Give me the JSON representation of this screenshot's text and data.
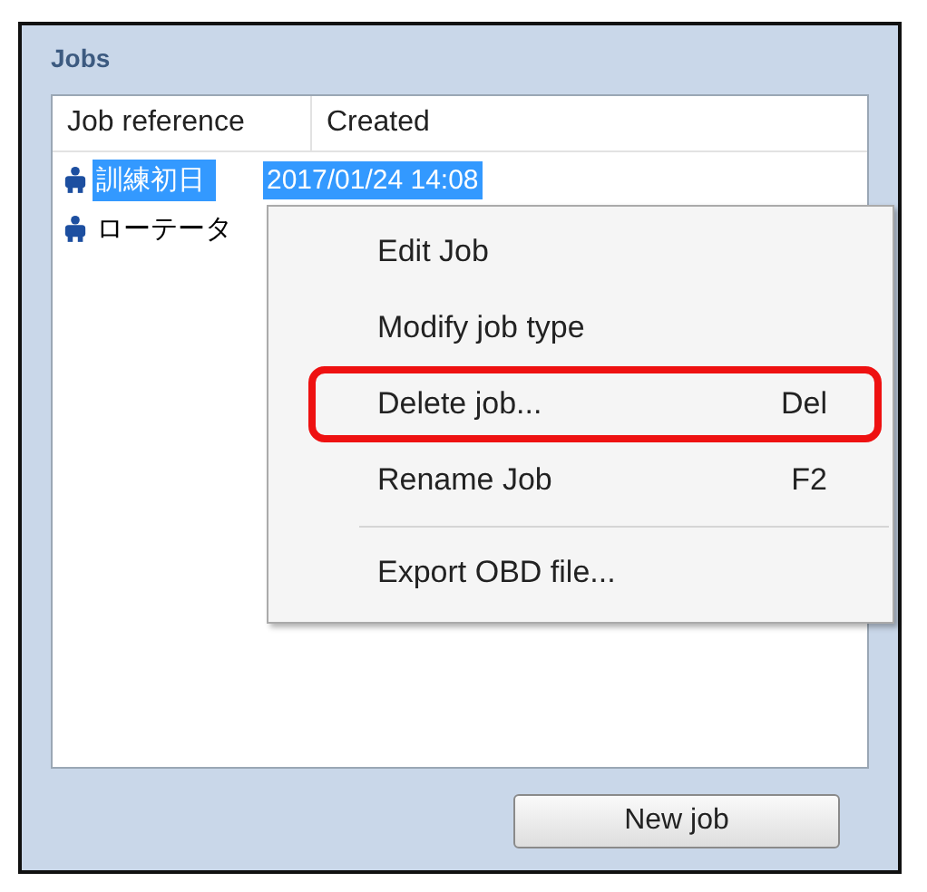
{
  "panel": {
    "title": "Jobs"
  },
  "table": {
    "columns": [
      "Job reference",
      "Created"
    ],
    "rows": [
      {
        "cells": [
          "訓練初日",
          "2017/01/24 14:08"
        ],
        "selected": true
      },
      {
        "cells": [
          "ローテータ"
        ],
        "selected": false
      }
    ]
  },
  "context_menu": {
    "items": [
      {
        "label": "Edit Job",
        "highlighted": false
      },
      {
        "label": "Modify job type",
        "highlighted": false
      },
      {
        "label": "Delete job...",
        "shortcut": "Del",
        "highlighted": true
      },
      {
        "label": "Rename Job",
        "shortcut": "F2",
        "highlighted": false,
        "separator_after": true
      },
      {
        "label": "Export OBD file...",
        "highlighted": false
      }
    ]
  },
  "buttons": [
    "New job"
  ]
}
